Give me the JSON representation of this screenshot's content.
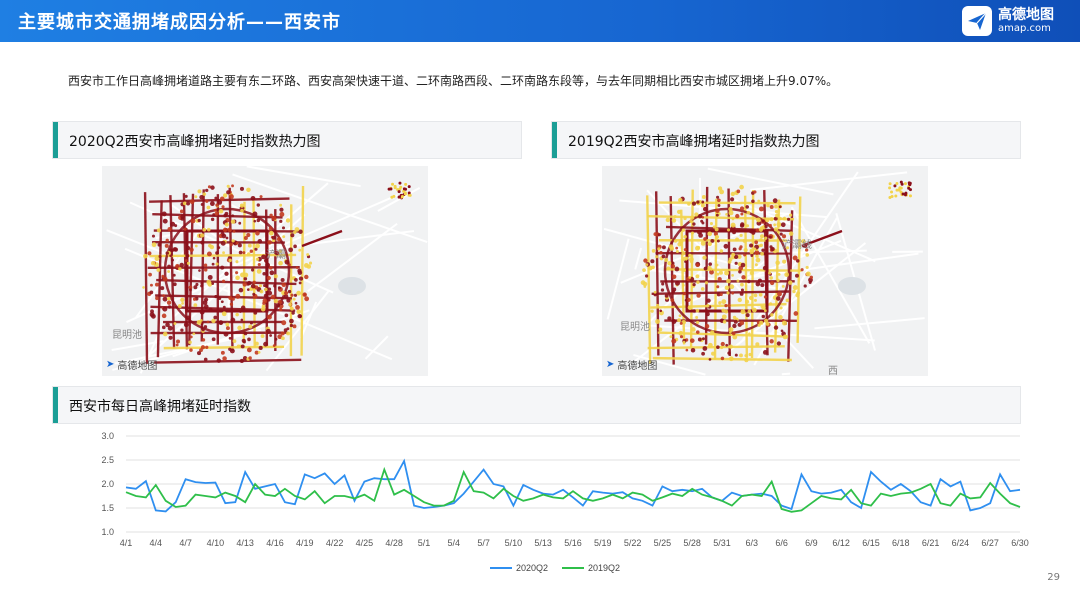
{
  "header": {
    "title": "主要城市交通拥堵成因分析——西安市",
    "logo_cn": "高德地图",
    "logo_en": "amap.com"
  },
  "intro": "西安市工作日高峰拥堵道路主要有东二环路、西安高架快速干道、二环南路西段、二环南路东段等，与去年同期相比西安市城区拥堵上升9.07%。",
  "panels": {
    "left_title": "2020Q2西安市高峰拥堵延时指数热力图",
    "right_title": "2019Q2西安市高峰拥堵延时指数热力图",
    "bottom_title": "西安市每日高峰拥堵延时指数"
  },
  "maps": {
    "left": {
      "place1": "昆明池",
      "place2": "浐灞",
      "brand": "高德地图"
    },
    "right": {
      "place1": "昆明池",
      "place2": "浐灞线",
      "place3": "西",
      "brand": "高德地图"
    }
  },
  "colors": {
    "header": "#1766d1",
    "series_2020": "#2f8ff0",
    "series_2019": "#2fbf4a",
    "panel_accent": "#1b9e96",
    "heat_high": "#8b0f1a",
    "heat_mid": "#c23a1f",
    "heat_low": "#f2d34b"
  },
  "chart_data": {
    "type": "line",
    "x": [
      "4/1",
      "4/2",
      "4/3",
      "4/4",
      "4/5",
      "4/6",
      "4/7",
      "4/8",
      "4/9",
      "4/10",
      "4/11",
      "4/12",
      "4/13",
      "4/14",
      "4/15",
      "4/16",
      "4/17",
      "4/18",
      "4/19",
      "4/20",
      "4/21",
      "4/22",
      "4/23",
      "4/24",
      "4/25",
      "4/26",
      "4/27",
      "4/28",
      "4/29",
      "4/30",
      "5/1",
      "5/2",
      "5/3",
      "5/4",
      "5/5",
      "5/6",
      "5/7",
      "5/8",
      "5/9",
      "5/10",
      "5/11",
      "5/12",
      "5/13",
      "5/14",
      "5/15",
      "5/16",
      "5/17",
      "5/18",
      "5/19",
      "5/20",
      "5/21",
      "5/22",
      "5/23",
      "5/24",
      "5/25",
      "5/26",
      "5/27",
      "5/28",
      "5/29",
      "5/30",
      "5/31",
      "6/1",
      "6/2",
      "6/3",
      "6/4",
      "6/5",
      "6/6",
      "6/7",
      "6/8",
      "6/9",
      "6/10",
      "6/11",
      "6/12",
      "6/13",
      "6/14",
      "6/15",
      "6/16",
      "6/17",
      "6/18",
      "6/19",
      "6/20",
      "6/21",
      "6/22",
      "6/23",
      "6/24",
      "6/25",
      "6/26",
      "6/27",
      "6/28",
      "6/29",
      "6/30"
    ],
    "tick_labels": [
      "4/1",
      "4/4",
      "4/7",
      "4/10",
      "4/13",
      "4/16",
      "4/19",
      "4/22",
      "4/25",
      "4/28",
      "5/1",
      "5/4",
      "5/7",
      "5/10",
      "5/13",
      "5/16",
      "5/19",
      "5/22",
      "5/25",
      "5/28",
      "5/31",
      "6/3",
      "6/6",
      "6/9",
      "6/12",
      "6/15",
      "6/18",
      "6/21",
      "6/24",
      "6/27",
      "6/30"
    ],
    "series": [
      {
        "name": "2020Q2",
        "values": [
          1.93,
          1.9,
          2.06,
          1.45,
          1.43,
          1.62,
          2.1,
          2.04,
          2.02,
          2.03,
          1.6,
          1.62,
          2.25,
          1.9,
          1.95,
          2.0,
          1.62,
          1.58,
          2.2,
          2.12,
          2.22,
          2.0,
          2.18,
          1.65,
          2.05,
          2.12,
          2.1,
          2.1,
          2.48,
          1.55,
          1.5,
          1.52,
          1.55,
          1.6,
          1.8,
          2.05,
          2.3,
          2.0,
          1.95,
          1.55,
          1.98,
          1.88,
          1.8,
          1.78,
          1.88,
          1.72,
          1.55,
          1.85,
          1.82,
          1.8,
          1.83,
          1.7,
          1.65,
          1.55,
          1.95,
          1.85,
          1.88,
          1.85,
          1.9,
          1.72,
          1.65,
          1.82,
          1.75,
          1.78,
          1.8,
          1.75,
          1.55,
          1.48,
          2.2,
          1.85,
          1.8,
          1.82,
          1.88,
          1.62,
          1.5,
          2.25,
          2.05,
          1.88,
          2.0,
          1.85,
          1.62,
          1.55,
          2.1,
          1.95,
          2.05,
          1.45,
          1.5,
          1.6,
          2.2,
          1.85,
          1.88
        ]
      },
      {
        "name": "2019Q2",
        "values": [
          1.83,
          1.75,
          1.72,
          1.98,
          1.65,
          1.52,
          1.55,
          1.78,
          1.75,
          1.72,
          1.82,
          1.75,
          1.62,
          2.0,
          1.78,
          1.75,
          1.9,
          1.75,
          1.68,
          1.85,
          1.6,
          1.75,
          1.75,
          1.7,
          1.78,
          1.65,
          2.3,
          1.78,
          1.88,
          1.75,
          1.62,
          1.55,
          1.55,
          1.65,
          2.25,
          1.85,
          1.82,
          1.7,
          1.9,
          1.75,
          1.65,
          1.7,
          1.78,
          1.72,
          1.7,
          1.85,
          1.7,
          1.65,
          1.7,
          1.78,
          1.7,
          1.82,
          1.78,
          1.65,
          1.72,
          1.8,
          1.75,
          1.9,
          1.78,
          1.72,
          1.65,
          1.55,
          1.75,
          1.78,
          1.75,
          2.05,
          1.48,
          1.42,
          1.45,
          1.6,
          1.75,
          1.7,
          1.68,
          1.88,
          1.6,
          1.55,
          1.8,
          1.75,
          1.8,
          1.82,
          1.9,
          2.0,
          1.6,
          1.55,
          1.8,
          1.7,
          1.72,
          2.02,
          1.8,
          1.6,
          1.52
        ]
      }
    ],
    "yticks": [
      "1.0",
      "1.5",
      "2.0",
      "2.5",
      "3.0"
    ],
    "ylim": [
      1.0,
      3.0
    ],
    "legend": "bottom-center",
    "grid": "horizontal"
  },
  "page_number": "29"
}
